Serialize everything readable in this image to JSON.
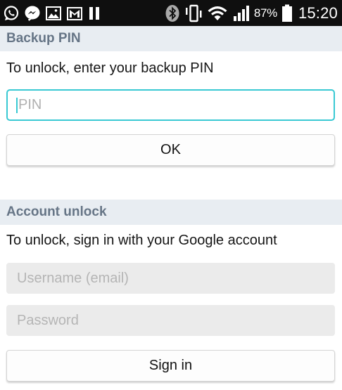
{
  "status_bar": {
    "left_icons": [
      "whatsapp-icon",
      "messenger-icon",
      "gallery-icon",
      "gmail-icon",
      "pause-icon"
    ],
    "right_icons": [
      "bluetooth-icon",
      "vibrate-icon",
      "wifi-icon",
      "signal-icon",
      "battery-icon"
    ],
    "battery_percent": "87%",
    "battery_level": 0.87,
    "time": "15:20"
  },
  "backup_pin": {
    "header": "Backup PIN",
    "instruction": "To unlock, enter your backup PIN",
    "pin_placeholder": "PIN",
    "ok_label": "OK"
  },
  "account_unlock": {
    "header": "Account unlock",
    "instruction": "To unlock, sign in with your Google account",
    "username_placeholder": "Username (email)",
    "password_placeholder": "Password",
    "sign_in_label": "Sign in"
  },
  "colors": {
    "status_bar": "#0f0f0f",
    "section_header_bg": "#e8edf2",
    "section_header_text": "#667586",
    "focus_accent": "#39c9d3"
  }
}
